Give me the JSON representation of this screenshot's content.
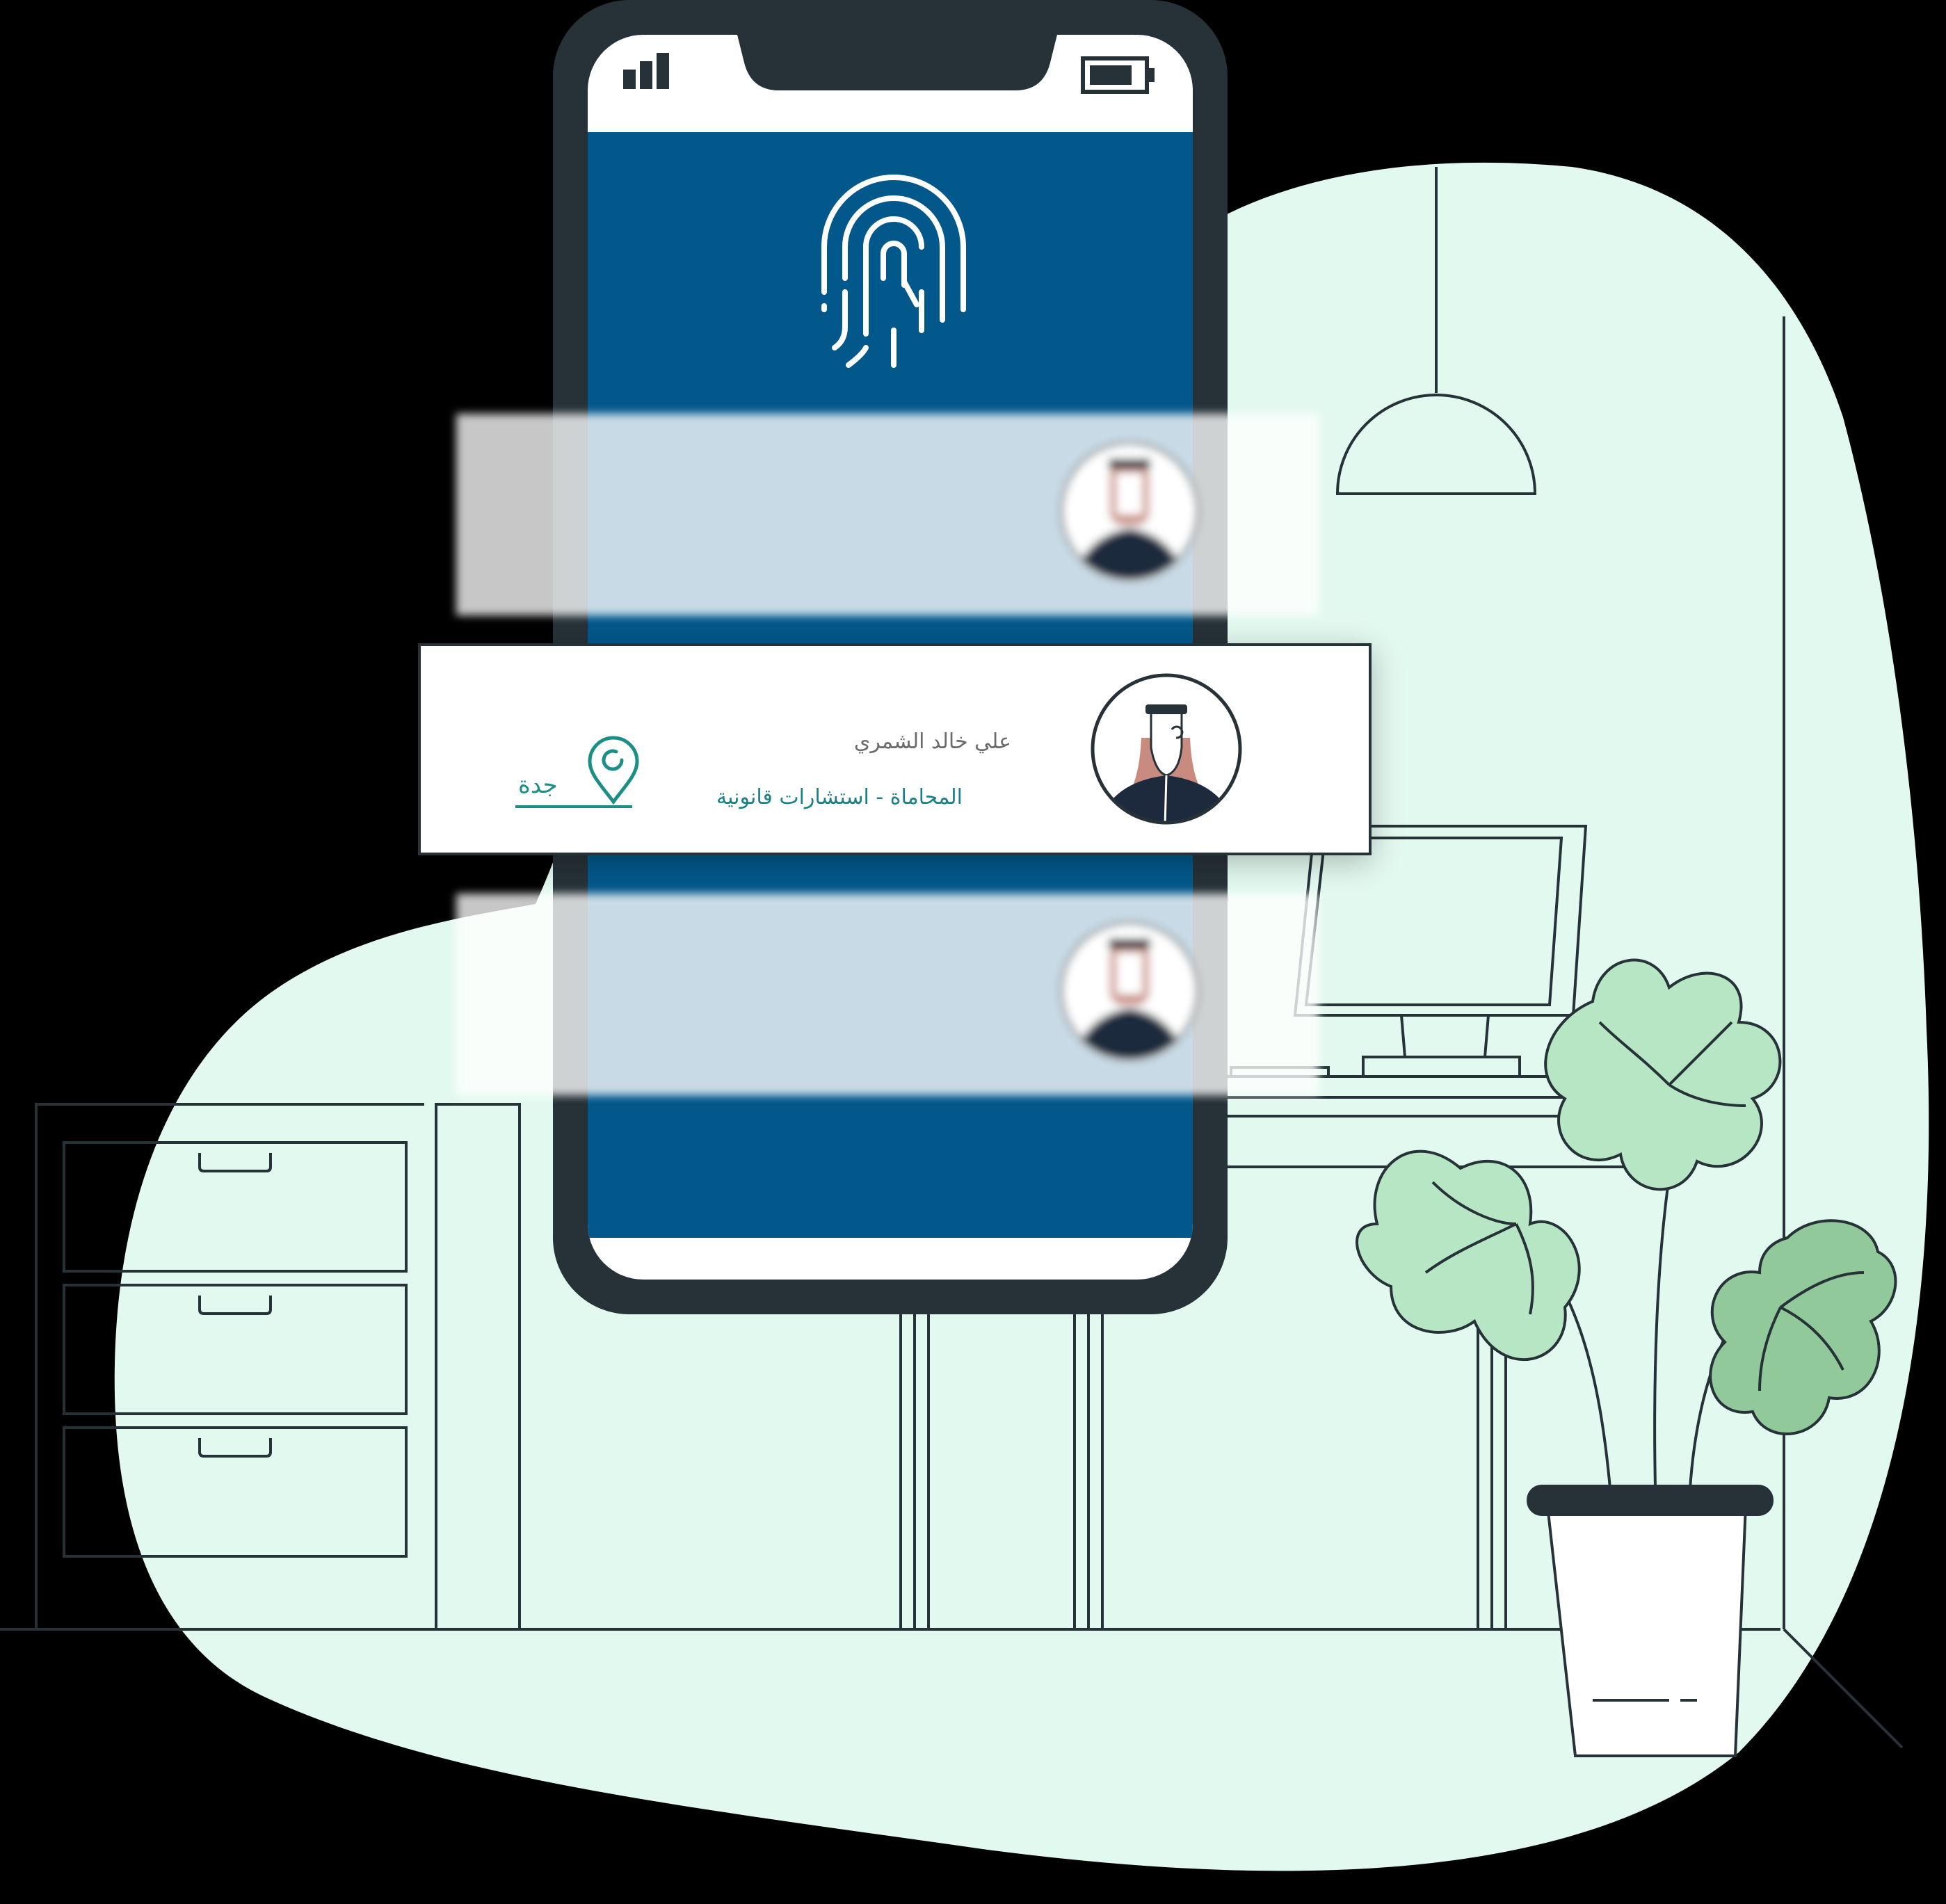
{
  "app": {
    "colors": {
      "background": "#000000",
      "blob": "#e2f9ef",
      "phone_frame": "#263238",
      "phone_screen": "#03588b",
      "accent_teal": "#1b8f86",
      "leaf_light": "#b6e6c4",
      "leaf_dark": "#92c99b"
    }
  },
  "phone": {
    "status_icons": [
      "signal-icon",
      "battery-icon"
    ],
    "logo_icon": "fingerprint-logo-icon"
  },
  "profile_card": {
    "name": "علي خالد الشمري",
    "description": "المحاماة - استشارات قانونية",
    "city": "جدة",
    "location_icon": "location-pin-icon",
    "avatar_icon": "avatar-man-ghutra-icon"
  },
  "blurred_cards": {
    "count": 2,
    "avatar_icon": "avatar-man-ghutra-icon"
  }
}
